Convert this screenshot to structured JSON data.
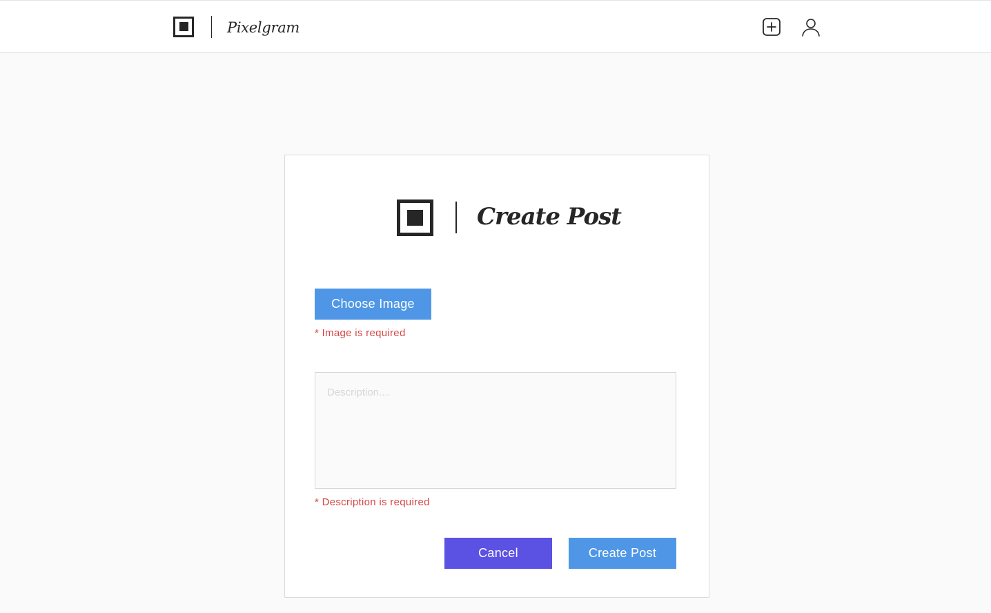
{
  "header": {
    "brand_name": "Pixelgram",
    "icons": {
      "add": "add-post-icon",
      "profile": "profile-icon"
    }
  },
  "form": {
    "title": "Create Post",
    "choose_image_label": "Choose Image",
    "image_error": "* Image is required",
    "description_placeholder": "Description....",
    "description_value": "",
    "description_error": "* Description is required",
    "cancel_label": "Cancel",
    "submit_label": "Create Post"
  },
  "colors": {
    "primary_blue": "#4f97e6",
    "cancel_purple": "#5b51e2",
    "error_red": "#d64545",
    "dark": "#262626"
  }
}
